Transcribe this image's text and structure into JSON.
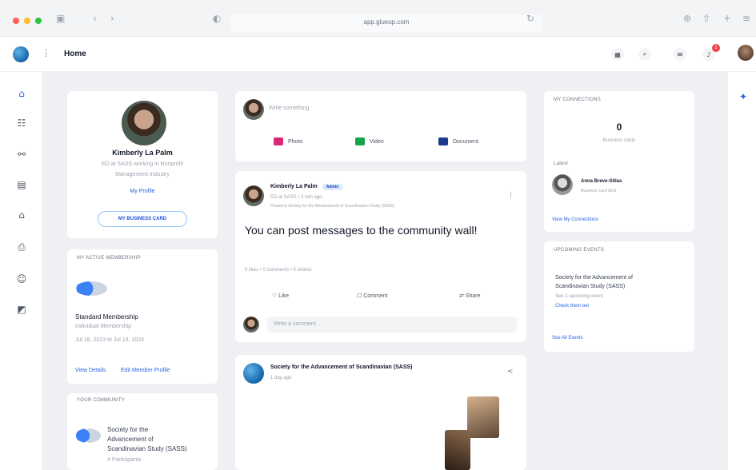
{
  "browser": {
    "url": "app.glueup.com",
    "traffic_lights": [
      "#ff5f57",
      "#febc2e",
      "#28c840"
    ]
  },
  "app": {
    "page_title": "Home",
    "notification_count": "2"
  },
  "nav_icons": [
    "home-icon",
    "community-icon",
    "network-icon",
    "calendar-icon",
    "store-icon",
    "printer-icon",
    "people-icon",
    "wallet-icon"
  ],
  "profile": {
    "name": "Kimberly La Palm",
    "title_line1": "ED at SASS working in Nonprofit",
    "title_line2": "Management Industry",
    "my_profile": "My Profile",
    "business_card": "MY BUSINESS CARD"
  },
  "membership": {
    "label": "MY ACTIVE MEMBERSHIP",
    "name": "Standard Membership",
    "type": "Individual Membership",
    "dates": "Jul 18, 2023 to Jul 18, 2024",
    "view_details": "View Details",
    "edit_profile": "Edit Member Profile"
  },
  "community": {
    "label": "YOUR COMMUNITY",
    "name_line1": "Society for the",
    "name_line2": "Advancement of",
    "name_line3": "Scandinavian Study (SASS)",
    "participants": "4 Participants"
  },
  "composer": {
    "placeholder": "Write something",
    "photo": "Photo",
    "video": "Video",
    "document": "Document"
  },
  "post": {
    "author": "Kimberly La Palm",
    "badge": "Admin",
    "meta": "ED at SASS • 2 min ago",
    "posted_in": "Posted in Society for the Advancement of Scandinavian Study (SASS)",
    "text": "You can post messages to the community wall!",
    "stats": "0 likes • 0 comments • 0 shares",
    "like": "Like",
    "comment": "Comment",
    "share": "Share",
    "comment_placeholder": "Write a comment..."
  },
  "post2": {
    "author": "Society for the Advancement of Scandinavian (SASS)",
    "time": "1 day ago"
  },
  "connections": {
    "label": "MY CONNECTIONS",
    "count": "0",
    "count_label": "Business cards",
    "latest_label": "Latest",
    "latest_name": "Anna Breve-Stilas",
    "latest_sub": "Business Card Sent",
    "view_link": "View My Connections"
  },
  "events": {
    "label": "UPCOMING EVENTS",
    "org_line1": "Society for the Advancement of",
    "org_line2": "Scandinavian Study (SASS)",
    "count": "See 1 upcoming event",
    "check": "Check them out",
    "see_all": "See All Events"
  },
  "colors": {
    "accent": "#2563eb",
    "photo": "#db2777",
    "video": "#16a34a",
    "document": "#1e3a8a"
  }
}
